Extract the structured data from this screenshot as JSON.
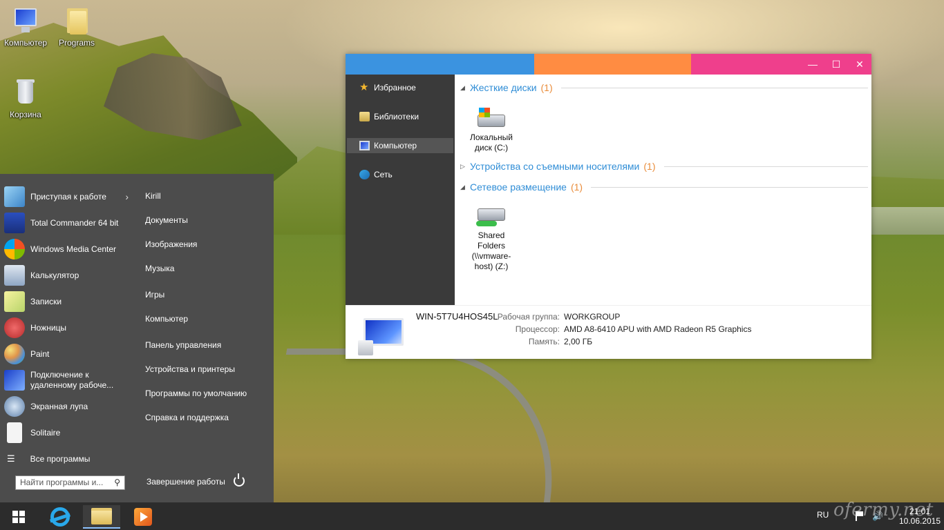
{
  "desktop": {
    "icons": [
      {
        "label": "Компьютер",
        "icon": "computer-icon"
      },
      {
        "label": "Programs",
        "icon": "folder-icon"
      },
      {
        "label": "Корзина",
        "icon": "recycle-bin-icon"
      }
    ],
    "watermark": "ofermy.net"
  },
  "start_menu": {
    "programs": [
      {
        "label": "Приступая к работе",
        "icon": "getting-started-icon",
        "has_submenu": true
      },
      {
        "label": "Total Commander 64 bit",
        "icon": "floppy-disk-icon"
      },
      {
        "label": "Windows Media Center",
        "icon": "media-center-icon"
      },
      {
        "label": "Калькулятор",
        "icon": "calculator-icon"
      },
      {
        "label": "Записки",
        "icon": "sticky-notes-icon"
      },
      {
        "label": "Ножницы",
        "icon": "scissors-icon"
      },
      {
        "label": "Paint",
        "icon": "paint-palette-icon"
      },
      {
        "label": "Подключение к удаленному рабоче...",
        "icon": "remote-desktop-icon"
      },
      {
        "label": "Экранная лупа",
        "icon": "magnifier-icon"
      },
      {
        "label": "Solitaire",
        "icon": "cards-icon"
      }
    ],
    "all_programs": "Все программы",
    "search_placeholder": "Найти программы и...",
    "places": [
      "Kirill",
      "Документы",
      "Изображения",
      "Музыка",
      "Игры",
      "Компьютер",
      "Панель управления",
      "Устройства и принтеры",
      "Программы по умолчанию",
      "Справка и поддержка"
    ],
    "shutdown_label": "Завершение работы"
  },
  "explorer": {
    "titlebar_colors": [
      "#3b93e0",
      "#ff8c42",
      "#ef3f8c"
    ],
    "controls": {
      "minimize": "—",
      "maximize": "☐",
      "close": "✕"
    },
    "nav": [
      {
        "label": "Избранное",
        "icon": "star-icon",
        "active": false
      },
      {
        "label": "Библиотеки",
        "icon": "library-icon",
        "active": false
      },
      {
        "label": "Компьютер",
        "icon": "computer-icon",
        "active": true
      },
      {
        "label": "Сеть",
        "icon": "network-icon",
        "active": false
      }
    ],
    "groups": [
      {
        "title": "Жесткие диски",
        "count": "(1)",
        "expanded": true,
        "items": [
          {
            "label": "Локальный диск (C:)"
          }
        ]
      },
      {
        "title": "Устройства со съемными носителями",
        "count": "(1)",
        "expanded": false,
        "items": []
      },
      {
        "title": "Сетевое размещение",
        "count": "(1)",
        "expanded": true,
        "items": [
          {
            "label": "Shared Folders (\\\\vmware-host) (Z:)"
          }
        ]
      }
    ],
    "details": {
      "computer_name": "WIN-5T7U4HOS45L",
      "workgroup_label": "Рабочая группа:",
      "workgroup_value": "WORKGROUP",
      "processor_label": "Процессор:",
      "processor_value": "AMD A8-6410 APU with AMD Radeon R5 Graphics",
      "memory_label": "Память:",
      "memory_value": "2,00 ГБ"
    }
  },
  "taskbar": {
    "apps": [
      {
        "name": "Internet Explorer",
        "icon": "internet-explorer-icon",
        "active": false
      },
      {
        "name": "File Explorer",
        "icon": "file-explorer-icon",
        "active": true
      },
      {
        "name": "Media Player",
        "icon": "media-player-icon",
        "active": false
      }
    ],
    "language": "RU",
    "time": "21:01",
    "date": "10.06.2015"
  }
}
